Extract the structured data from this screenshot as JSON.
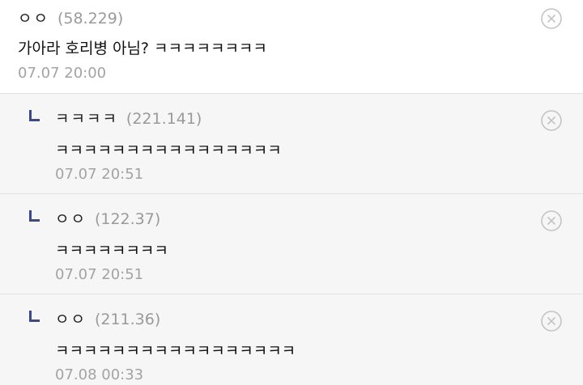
{
  "comments": [
    {
      "author": "ㅇㅇ",
      "ip": "(58.229)",
      "text": "가아라 호리병 아님? ㅋㅋㅋㅋㅋㅋㅋㅋ",
      "date": "07.07 20:00",
      "is_reply": false
    },
    {
      "author": "ㅋㅋㅋㅋ",
      "ip": "(221.141)",
      "text": "ㅋㅋㅋㅋㅋㅋㅋㅋㅋㅋㅋㅋㅋㅋㅋㅋ",
      "date": "07.07 20:51",
      "is_reply": true
    },
    {
      "author": "ㅇㅇ",
      "ip": "(122.37)",
      "text": "ㅋㅋㅋㅋㅋㅋㅋㅋ",
      "date": "07.07 20:51",
      "is_reply": true
    },
    {
      "author": "ㅇㅇ",
      "ip": "(211.36)",
      "text": "ㅋㅋㅋㅋㅋㅋㅋㅋㅋㅋㅋㅋㅋㅋㅋㅋㅋ",
      "date": "07.08 00:33",
      "is_reply": true
    }
  ],
  "icons": {
    "delete": "close-circle-icon",
    "reply": "reply-arrow-icon"
  },
  "colors": {
    "reply_arrow": "#3d4a82",
    "reply_bg": "#f6f6f7",
    "meta_gray": "#9a9a9a"
  }
}
